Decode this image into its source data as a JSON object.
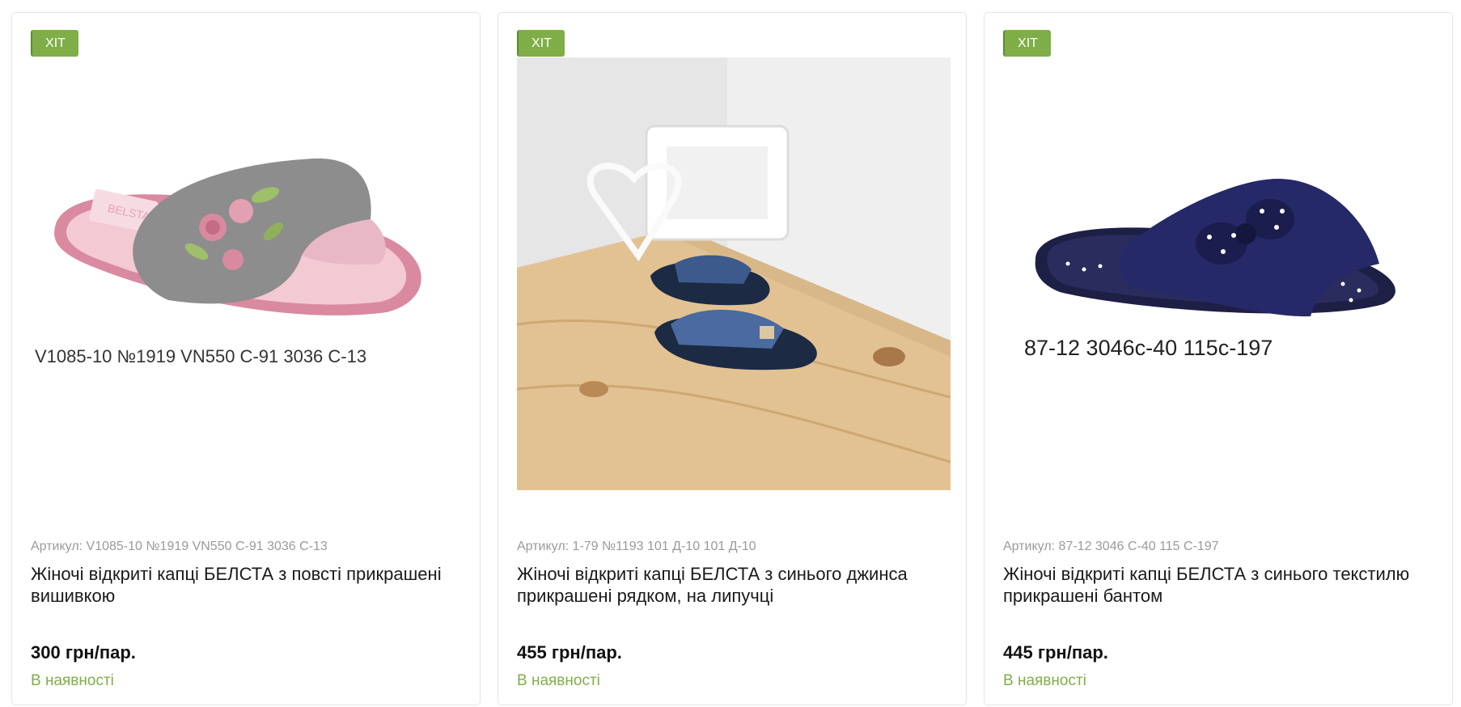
{
  "products": [
    {
      "badge": "ХІТ",
      "image_caption": "V1085-10 №1919 VN550 С-91 3036 С-13",
      "sku": "Артикул: V1085-10 №1919 VN550 С-91 3036 С-13",
      "title": "Жіночі відкриті капці БЕЛСТА з повсті прикрашені вишивкою",
      "price": "300 грн/пар.",
      "stock": "В наявності"
    },
    {
      "badge": "ХІТ",
      "image_caption": "",
      "sku": "Артикул: 1-79 №1193 101 Д-10 101 Д-10",
      "title": "Жіночі відкриті капці БЕЛСТА з синього джинса прикрашені рядком, на липучці",
      "price": "455 грн/пар.",
      "stock": "В наявності"
    },
    {
      "badge": "ХІТ",
      "image_caption": "87-12 3046с-40 115с-197",
      "sku": "Артикул: 87-12 3046 С-40 115 С-197",
      "title": "Жіночі відкриті капці БЕЛСТА з синього текстилю прикрашені бантом",
      "price": "445 грн/пар.",
      "stock": "В наявності"
    }
  ],
  "colors": {
    "badge": "#7fae48",
    "stock": "#7fae48",
    "sku": "#9a9a9a"
  }
}
